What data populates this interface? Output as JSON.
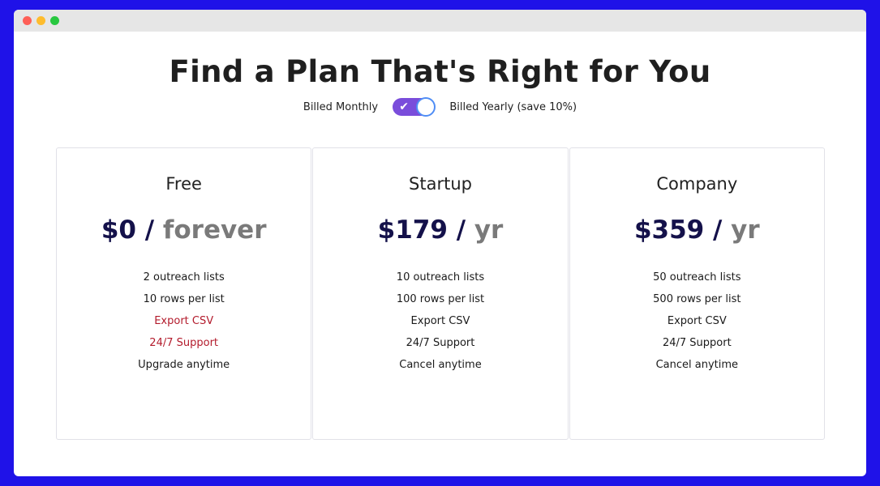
{
  "window": {
    "title_bar_buttons": [
      "close",
      "minimize",
      "maximize"
    ]
  },
  "header": {
    "title": "Find a Plan That's Right for You"
  },
  "billing_toggle": {
    "left_label": "Billed Monthly",
    "right_label": "Billed Yearly (save 10%)",
    "checked": true,
    "check_glyph": "✔"
  },
  "plans": [
    {
      "name": "Free",
      "amount": "$0",
      "separator": "/",
      "period": "forever",
      "features": [
        {
          "text": "2 outreach lists",
          "available": true
        },
        {
          "text": "10 rows per list",
          "available": true
        },
        {
          "text": "Export CSV",
          "available": false
        },
        {
          "text": "24/7 Support",
          "available": false
        },
        {
          "text": "Upgrade anytime",
          "available": true
        }
      ]
    },
    {
      "name": "Startup",
      "amount": "$179",
      "separator": "/",
      "period": "yr",
      "features": [
        {
          "text": "10 outreach lists",
          "available": true
        },
        {
          "text": "100 rows per list",
          "available": true
        },
        {
          "text": "Export CSV",
          "available": true
        },
        {
          "text": "24/7 Support",
          "available": true
        },
        {
          "text": "Cancel anytime",
          "available": true
        }
      ]
    },
    {
      "name": "Company",
      "amount": "$359",
      "separator": "/",
      "period": "yr",
      "features": [
        {
          "text": "50 outreach lists",
          "available": true
        },
        {
          "text": "500 rows per list",
          "available": true
        },
        {
          "text": "Export CSV",
          "available": true
        },
        {
          "text": "24/7 Support",
          "available": true
        },
        {
          "text": "Cancel anytime",
          "available": true
        }
      ]
    }
  ],
  "colors": {
    "page_background": "#1f12e8",
    "toggle_track": "#7a4ddb",
    "toggle_knob_border": "#4f8df5",
    "price_amount": "#14114a",
    "price_period": "#7a7a7a",
    "unavailable_feature": "#b31b2c"
  }
}
